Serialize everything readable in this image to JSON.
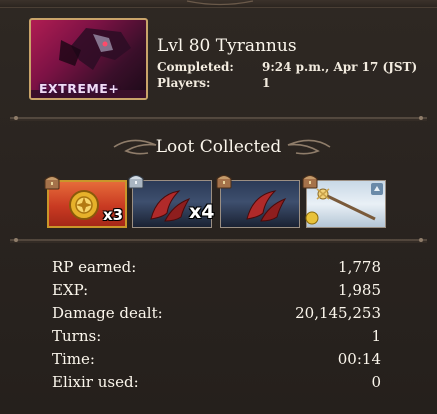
{
  "raid": {
    "title": "Lvl 80 Tyrannus",
    "difficulty": "EXTREME+",
    "completed_label": "Completed:",
    "completed_value": "9:24 p.m., Apr 17 (JST)",
    "players_label": "Players:",
    "players_value": "1"
  },
  "loot": {
    "title": "Loot Collected",
    "items": [
      {
        "name": "Gold medallion",
        "quantity": "x3",
        "chest": "bronze"
      },
      {
        "name": "Crimson horn",
        "quantity": "x4",
        "chest": "silver"
      },
      {
        "name": "Crimson horn",
        "quantity": "",
        "chest": "bronze"
      },
      {
        "name": "Staff weapon",
        "quantity": "",
        "chest": "bronze"
      }
    ]
  },
  "stats": {
    "rp_label": "RP earned:",
    "rp_value": "1,778",
    "exp_label": "EXP:",
    "exp_value": "1,985",
    "damage_label": "Damage dealt:",
    "damage_value": "20,145,253",
    "turns_label": "Turns:",
    "turns_value": "1",
    "time_label": "Time:",
    "time_value": "00:14",
    "elixir_label": "Elixir used:",
    "elixir_value": "0"
  },
  "colors": {
    "background": "#2a2420",
    "text": "#f3ece0",
    "gold_border": "#c9a46a",
    "badge": "#f0dcf5"
  }
}
